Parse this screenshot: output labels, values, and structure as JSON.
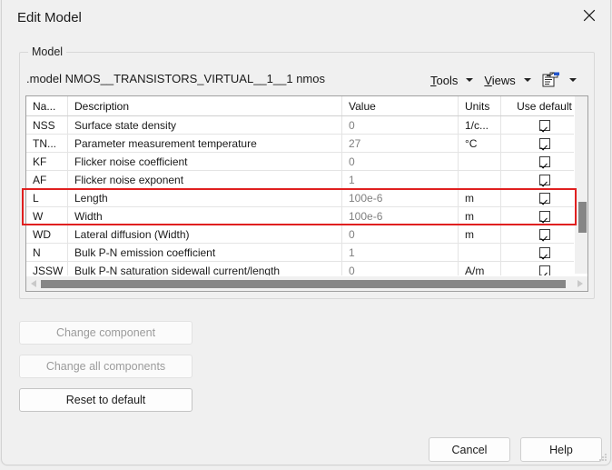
{
  "window": {
    "title": "Edit Model",
    "close_icon": "close-icon"
  },
  "group": {
    "legend": "Model",
    "model_line": ".model NMOS__TRANSISTORS_VIRTUAL__1__1   nmos"
  },
  "menu": {
    "tools": {
      "mnemonic": "T",
      "rest": "ools"
    },
    "views": {
      "mnemonic": "V",
      "rest": "iews"
    },
    "icon": "clipboard-notes-icon"
  },
  "table": {
    "headers": {
      "name": "Na...",
      "description": "Description",
      "value": "Value",
      "units": "Units",
      "use_default": "Use default"
    },
    "rows": [
      {
        "name": "NSS",
        "description": "Surface state density",
        "value": "0",
        "units": "1/c...",
        "use_default": true,
        "highlighted": false
      },
      {
        "name": "TN...",
        "description": "Parameter measurement temperature",
        "value": "27",
        "units": "°C",
        "use_default": true,
        "highlighted": false
      },
      {
        "name": "KF",
        "description": "Flicker noise coefficient",
        "value": "0",
        "units": "",
        "use_default": true,
        "highlighted": false
      },
      {
        "name": "AF",
        "description": "Flicker noise exponent",
        "value": "1",
        "units": "",
        "use_default": true,
        "highlighted": false
      },
      {
        "name": "L",
        "description": "Length",
        "value": "100e-6",
        "units": "m",
        "use_default": true,
        "highlighted": true
      },
      {
        "name": "W",
        "description": "Width",
        "value": "100e-6",
        "units": "m",
        "use_default": true,
        "highlighted": true
      },
      {
        "name": "WD",
        "description": "Lateral diffusion (Width)",
        "value": "0",
        "units": "m",
        "use_default": true,
        "highlighted": false
      },
      {
        "name": "N",
        "description": "Bulk P-N emission coefficient",
        "value": "1",
        "units": "",
        "use_default": true,
        "highlighted": false
      },
      {
        "name": "JSSW",
        "description": "Bulk P-N saturation sidewall current/length",
        "value": "0",
        "units": "A/m",
        "use_default": true,
        "highlighted": false
      }
    ]
  },
  "buttons": {
    "change_component": "Change component",
    "change_all_components": "Change all components",
    "reset_to_default": "Reset to default",
    "cancel": "Cancel",
    "help": "Help"
  },
  "background": {
    "partial_text": "Edit model"
  }
}
